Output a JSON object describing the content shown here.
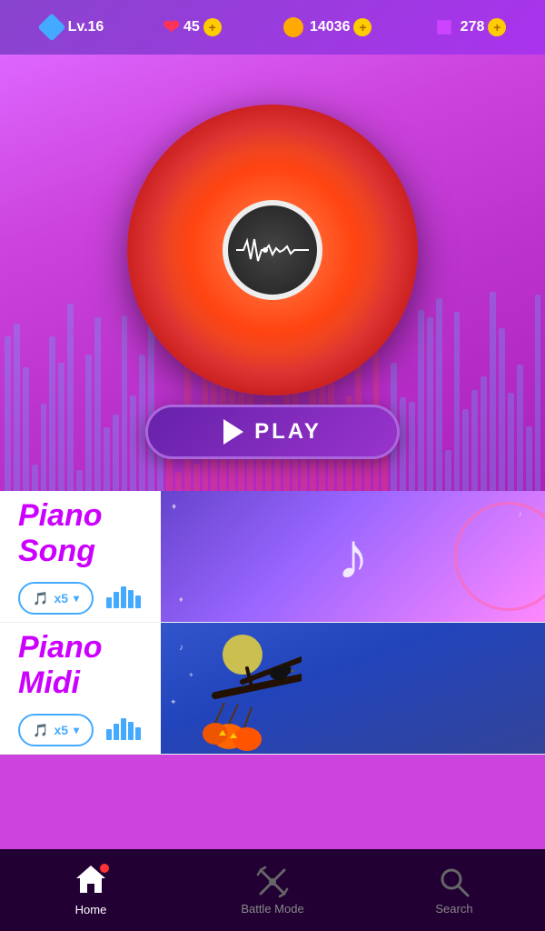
{
  "topBar": {
    "level": "Lv.16",
    "hearts": "45",
    "coins": "14036",
    "gems": "278",
    "plusLabel": "+"
  },
  "playButton": {
    "label": "PLAY"
  },
  "songCards": [
    {
      "title": "Piano Song",
      "ticketLabel": "x5",
      "imageTheme": "piano-song"
    },
    {
      "title": "Piano Midi",
      "ticketLabel": "x5",
      "imageTheme": "piano-midi"
    }
  ],
  "bottomNav": {
    "items": [
      {
        "id": "home",
        "label": "Home",
        "active": true
      },
      {
        "id": "battle",
        "label": "Battle Mode",
        "active": false
      },
      {
        "id": "search",
        "label": "Search",
        "active": false
      }
    ]
  }
}
